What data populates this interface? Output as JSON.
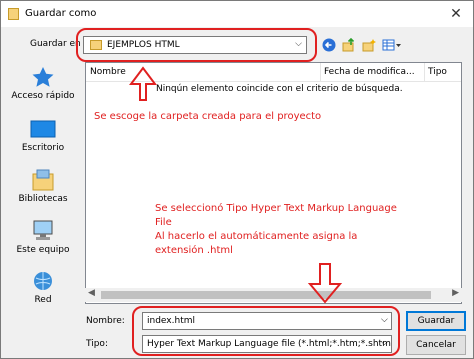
{
  "window": {
    "title": "Guardar como",
    "close_glyph": "✕"
  },
  "toolbar": {
    "save_in_label": "Guardar en",
    "save_in_value": "EJEMPLOS HTML",
    "icons": [
      "back-arrow-icon",
      "up-folder-icon",
      "new-folder-icon",
      "view-menu-icon"
    ]
  },
  "places": [
    {
      "label": "Acceso rápido",
      "icon": "star-icon"
    },
    {
      "label": "Escritorio",
      "icon": "desktop-icon"
    },
    {
      "label": "Bibliotecas",
      "icon": "libraries-icon"
    },
    {
      "label": "Este equipo",
      "icon": "computer-icon"
    },
    {
      "label": "Red",
      "icon": "network-icon"
    }
  ],
  "filelist": {
    "columns": [
      "Nombre",
      "Fecha de modifica...",
      "Tipo"
    ],
    "empty_message": "Ninqún elemento coincide con el criterio de búsqueda."
  },
  "form": {
    "name_label": "Nombre:",
    "name_value": "index.html",
    "type_label": "Tipo:",
    "type_value": "Hyper Text Markup Language file (*.html;*.htm;*.shtml;*.sl"
  },
  "buttons": {
    "save": "Guardar",
    "cancel": "Cancelar"
  },
  "annotations": {
    "folder_note": "Se escoge la carpeta creada para el proyecto",
    "type_note_1": "Se seleccionó Tipo Hyper Text Markup Language",
    "type_note_2": "File",
    "type_note_3": "Al hacerlo el automáticamente asigna la",
    "type_note_4": "extensión .html"
  },
  "colors": {
    "annotation": "#e02020",
    "accent": "#0078d7"
  }
}
